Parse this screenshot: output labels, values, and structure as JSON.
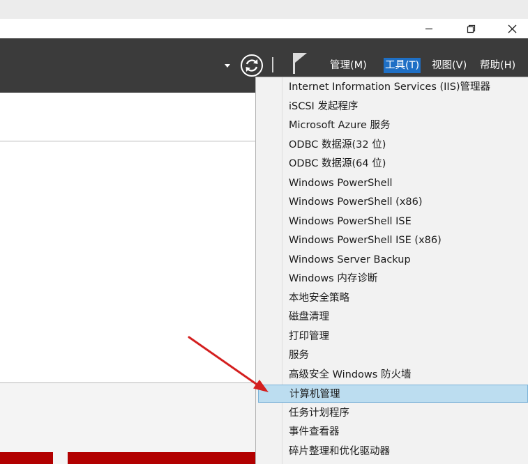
{
  "window_controls": {
    "minimize_icon": "minimize-icon",
    "restore_icon": "restore-icon",
    "close_icon": "close-icon"
  },
  "toolbar": {
    "menus": [
      {
        "label": "管理(M)",
        "active": false
      },
      {
        "label": "工具(T)",
        "active": true
      },
      {
        "label": "视图(V)",
        "active": false
      },
      {
        "label": "帮助(H)",
        "active": false
      }
    ]
  },
  "tools_menu": {
    "items": [
      {
        "label": "Internet Information Services (IIS)管理器"
      },
      {
        "label": "iSCSI 发起程序"
      },
      {
        "label": "Microsoft Azure 服务"
      },
      {
        "label": "ODBC 数据源(32 位)"
      },
      {
        "label": "ODBC 数据源(64 位)"
      },
      {
        "label": "Windows PowerShell"
      },
      {
        "label": "Windows PowerShell (x86)"
      },
      {
        "label": "Windows PowerShell ISE"
      },
      {
        "label": "Windows PowerShell ISE (x86)"
      },
      {
        "label": "Windows Server Backup"
      },
      {
        "label": "Windows 内存诊断"
      },
      {
        "label": "本地安全策略"
      },
      {
        "label": "磁盘清理"
      },
      {
        "label": "打印管理"
      },
      {
        "label": "服务"
      },
      {
        "label": "高级安全 Windows 防火墙"
      },
      {
        "label": "计算机管理",
        "highlighted": true
      },
      {
        "label": "任务计划程序"
      },
      {
        "label": "事件查看器"
      },
      {
        "label": "碎片整理和优化驱动器"
      }
    ]
  },
  "colors": {
    "toolbar_bg": "#3b3b3b",
    "menu_active_bg": "#1e6fc5",
    "highlight_bg": "#bcddf0",
    "arrow": "#d42020",
    "tile_red": "#b20000"
  }
}
